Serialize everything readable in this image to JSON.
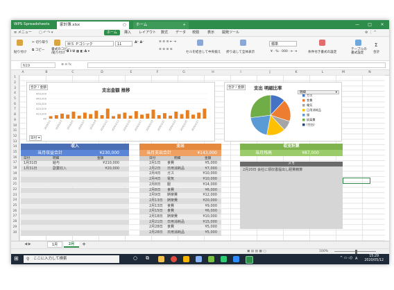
{
  "window": {
    "app_name": "WPS Spreadsheets",
    "tabs": [
      {
        "label": "家計簿.xlsx",
        "close": "○"
      },
      {
        "label": "ホーム",
        "close": "+"
      }
    ],
    "controls": [
      "—",
      "□",
      "×"
    ]
  },
  "menu": {
    "menu_label": "メニュー",
    "items": [
      "ホーム",
      "挿入",
      "レイアウト",
      "数式",
      "データ",
      "校閲",
      "表示",
      "開発ツール"
    ]
  },
  "ribbon": {
    "paste": "貼り付け",
    "cut": "切り取り",
    "copy": "コピー",
    "format_painter": "書式のコピー\n/貼り付け",
    "font_name": "ＭＳ Ｐゴシック",
    "font_size": "11",
    "merge_center": "セルを結合して中央揃え",
    "wrap_text": "折り返して全体表示",
    "number_format": "標準",
    "conditional_format": "条件付き書式の設定",
    "table_style": "テーブルの\n書式設定",
    "sum": "合計"
  },
  "formula_bar": {
    "name_box": "N19",
    "formula": ""
  },
  "columns": [
    "A",
    "B",
    "C",
    "D",
    "E",
    "F",
    "G",
    "H",
    "I",
    "J",
    "K",
    "L",
    "M",
    "N"
  ],
  "rows": [
    "1",
    "2",
    "3",
    "4",
    "5",
    "6",
    "7",
    "8",
    "9",
    "10",
    "11",
    "12",
    "13",
    "14",
    "15",
    "16",
    "17",
    "18",
    "19",
    "20",
    "21",
    "22",
    "23",
    "24",
    "25",
    "26",
    "27",
    "28",
    "29",
    "30"
  ],
  "bar_chart": {
    "tag": "合計 / 金額",
    "filter_tag": "日付",
    "title": "支出金額 推移",
    "y_ticks": [
      "¥50,000",
      "¥40,000",
      "¥30,000",
      "¥20,000",
      "¥10,000",
      "¥0"
    ]
  },
  "pie_chart": {
    "tag": "合計 / 金額",
    "title": "支出 明細比率",
    "dropdown": "明細"
  },
  "chart_data": [
    {
      "type": "bar",
      "title": "支出金額 推移",
      "categories": [
        "2020/2/1",
        "2020/2/2",
        "2020/2/3",
        "2020/2/4",
        "2020/2/5",
        "2020/2/6",
        "2020/2/7",
        "2020/2/8",
        "2020/2/9",
        "2020/2/10",
        "2020/2/11",
        "2020/2/12",
        "2020/2/13",
        "2020/2/14",
        "2020/2/15",
        "2020/2/16",
        "2020/2/17",
        "2020/2/18",
        "2020/2/19",
        "2020/2/20",
        "2020/2/21",
        "2020/2/22",
        "2020/2/23",
        "2020/2/24",
        "2020/2/25",
        "2020/2/26",
        "2020/2/27",
        "2020/2/28"
      ],
      "values": [
        5000,
        7000,
        10000,
        8000,
        14000,
        6000,
        12000,
        9000,
        16000,
        7000,
        20000,
        5000,
        9000,
        12000,
        6000,
        15000,
        8000,
        10000,
        18000,
        7000,
        11000,
        6000,
        14000,
        9000,
        17000,
        8000,
        12000,
        20000
      ],
      "ylim": [
        0,
        50000
      ],
      "color": "#e67e22"
    },
    {
      "type": "pie",
      "title": "支出 明細比率",
      "labels": [
        "ガス",
        "食費",
        "電気",
        "日用消耗品",
        "服",
        "娯楽費",
        "(空白)"
      ],
      "values": [
        12,
        18,
        8,
        15,
        20,
        27,
        0
      ],
      "colors": [
        "#4472c4",
        "#ed7d31",
        "#a5a5a5",
        "#ffc000",
        "#5b9bd5",
        "#70ad47",
        "#264478"
      ]
    }
  ],
  "income": {
    "header": "収入",
    "total_label": "当月収益合計",
    "total_value": "¥230,000",
    "columns": [
      "日付",
      "明細",
      "金額"
    ],
    "rows": [
      [
        "1月31日",
        "給与",
        "¥210,000"
      ],
      [
        "1月31日",
        "副業収入",
        "¥20,000"
      ]
    ]
  },
  "expense": {
    "header": "支出",
    "total_label": "当月支出合計",
    "total_value": "¥143,000",
    "columns": [
      "日付",
      "明細",
      "金額"
    ],
    "rows": [
      [
        "2月1日",
        "食費",
        "¥5,000"
      ],
      [
        "2月2日",
        "日用消耗品",
        "¥7,000"
      ],
      [
        "2月4日",
        "ガス",
        "¥10,000"
      ],
      [
        "2月4日",
        "電気",
        "¥10,000"
      ],
      [
        "2月8日",
        "服",
        "¥14,000"
      ],
      [
        "2月8日",
        "食費",
        "¥6,000"
      ],
      [
        "2月9日",
        "娯楽費",
        "¥12,000"
      ],
      [
        "2月13日",
        "娯楽費",
        "¥20,000"
      ],
      [
        "2月13日",
        "食費",
        "¥9,000"
      ],
      [
        "2月15日",
        "食費",
        "¥6,000"
      ],
      [
        "2月18日",
        "娯楽費",
        "¥10,000"
      ],
      [
        "2月21日",
        "日用消耗品",
        "¥15,000"
      ],
      [
        "2月28日",
        "食費",
        "¥5,000"
      ],
      [
        "2月28日",
        "日用消耗品",
        "¥5,000"
      ]
    ]
  },
  "balance": {
    "header": "収支計算",
    "label": "当月残高",
    "value": "¥87,000",
    "memo_header": "メモ",
    "memo_text": "2月20日 会社に領収書提出し経費精算"
  },
  "sheet_tabs": [
    "1月",
    "2月"
  ],
  "status": {
    "zoom": "100%"
  },
  "taskbar": {
    "search_placeholder": "ここに入力して検索",
    "time": "15:29",
    "date": "2020/05/12",
    "ime": "A"
  }
}
